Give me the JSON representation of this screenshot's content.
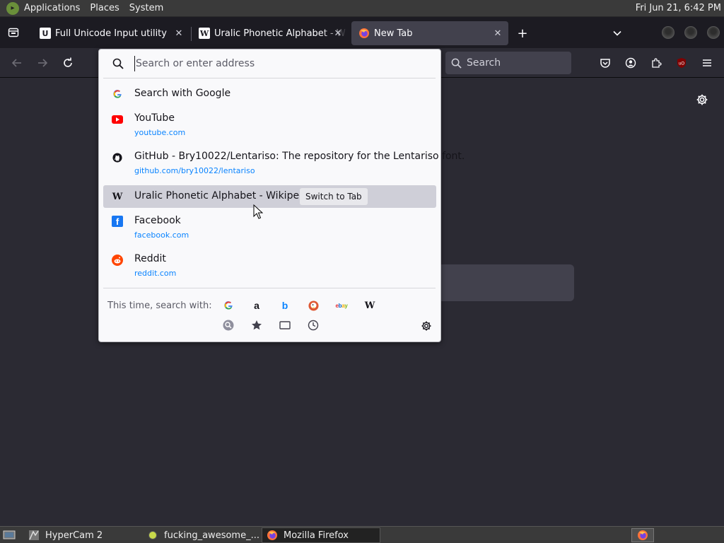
{
  "top_panel": {
    "menus": [
      "Applications",
      "Places",
      "System"
    ],
    "clock": "Fri Jun 21,  6:42 PM"
  },
  "tabs": [
    {
      "label": "Full Unicode Input utility",
      "icon": "unicode-favicon-icon",
      "selected": false
    },
    {
      "label": "Uralic Phonetic Alphabet - W",
      "icon": "wikipedia-favicon-icon",
      "selected": false
    },
    {
      "label": "New Tab",
      "icon": "firefox-favicon-icon",
      "selected": true
    }
  ],
  "navbar": {
    "search_placeholder": "Search"
  },
  "urlbar": {
    "placeholder": "Search or enter address",
    "results": [
      {
        "title": "Search with Google",
        "url": "",
        "icon": "google-icon"
      },
      {
        "title": "YouTube",
        "url": "youtube.com",
        "icon": "youtube-icon"
      },
      {
        "title": "GitHub - Bry10022/Lentariso: The repository for the Lentariso font.",
        "url": "github.com/bry10022/lentariso",
        "icon": "github-icon"
      },
      {
        "title": "Uralic Phonetic Alphabet - Wikipedia",
        "url": "",
        "icon": "wikipedia-icon",
        "action": "Switch to Tab",
        "selected": true
      },
      {
        "title": "Facebook",
        "url": "facebook.com",
        "icon": "facebook-icon"
      },
      {
        "title": "Reddit",
        "url": "reddit.com",
        "icon": "reddit-icon"
      }
    ],
    "oneoff_label": "This time, search with:",
    "engines": [
      "google-icon",
      "amazon-icon",
      "bing-icon",
      "duckduckgo-icon",
      "ebay-icon",
      "wikipedia-icon"
    ],
    "local_sources": [
      "search-icon",
      "bookmark-star-icon",
      "tabs-icon",
      "history-clock-icon"
    ]
  },
  "taskbar": {
    "tasks": [
      {
        "label": "HyperCam 2",
        "icon": "hypercam-icon"
      },
      {
        "label": "fucking_awesome_...",
        "icon": "file-icon"
      },
      {
        "label": "Mozilla Firefox",
        "icon": "firefox-icon"
      }
    ]
  },
  "colors": {
    "browser_dark": "#2b2a33",
    "panel_bg": "#f9f9fb",
    "selected_row": "#cfcfd8",
    "url_link": "#0a84ff"
  }
}
